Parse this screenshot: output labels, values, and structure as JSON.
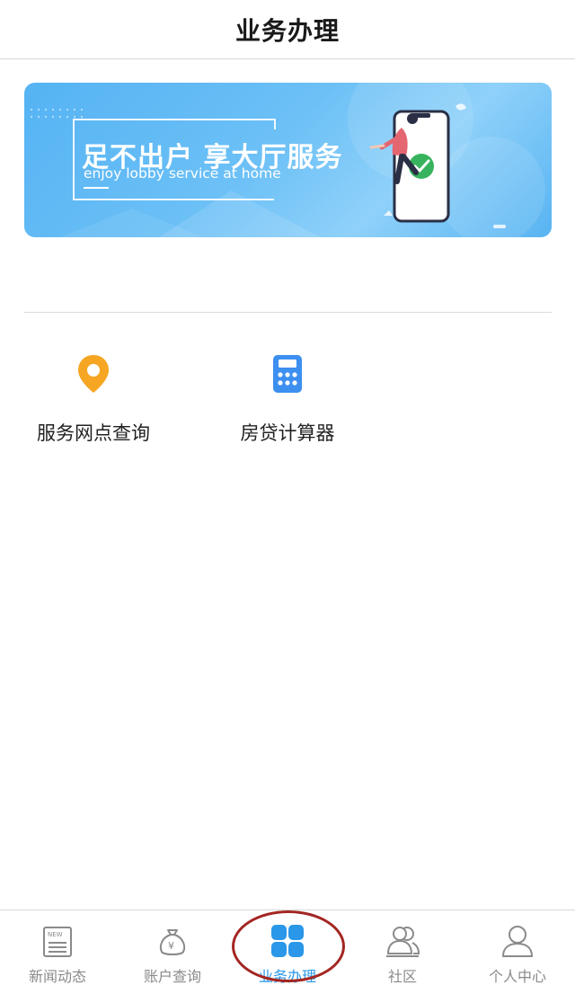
{
  "header": {
    "title": "业务办理"
  },
  "banner": {
    "title": "足不出户 享大厅服务",
    "subtitle": "enjoy lobby service at home"
  },
  "services": [
    {
      "label": "服务网点查询",
      "icon": "location-pin-icon",
      "color": "#f6a623"
    },
    {
      "label": "房贷计算器",
      "icon": "calculator-icon",
      "color": "#3d8ff0"
    }
  ],
  "tabbar": {
    "active_color": "#2a97e8",
    "inactive_color": "#8a8a8a",
    "items": [
      {
        "label": "新闻动态",
        "icon": "news-icon",
        "active": false
      },
      {
        "label": "账户查询",
        "icon": "money-bag-icon",
        "active": false
      },
      {
        "label": "业务办理",
        "icon": "grid-icon",
        "active": true
      },
      {
        "label": "社区",
        "icon": "community-icon",
        "active": false
      },
      {
        "label": "个人中心",
        "icon": "user-icon",
        "active": false
      }
    ]
  },
  "annotation": {
    "color": "#a32622"
  }
}
